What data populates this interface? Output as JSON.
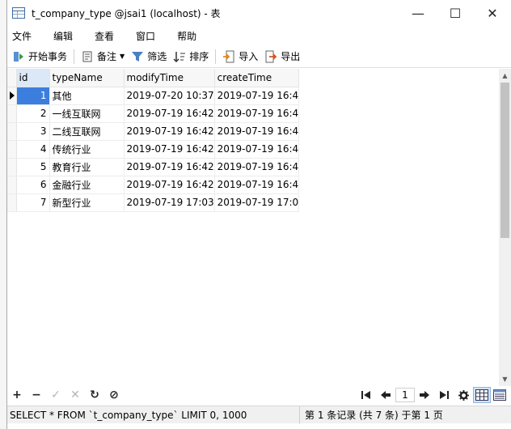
{
  "window": {
    "title": "t_company_type @jsai1 (localhost) - 表",
    "minimize": "—",
    "maximize": "☐",
    "close": "✕"
  },
  "menu": [
    "文件",
    "编辑",
    "查看",
    "窗口",
    "帮助"
  ],
  "toolbar": {
    "begin_transaction": "开始事务",
    "memo": "备注",
    "filter": "筛选",
    "sort": "排序",
    "import": "导入",
    "export": "导出"
  },
  "grid": {
    "columns": [
      "id",
      "typeName",
      "modifyTime",
      "createTime"
    ],
    "rows": [
      {
        "id": "1",
        "typeName": "其他",
        "modifyTime": "2019-07-20 10:37",
        "createTime": "2019-07-19 16:4"
      },
      {
        "id": "2",
        "typeName": "一线互联网",
        "modifyTime": "2019-07-19 16:42",
        "createTime": "2019-07-19 16:4"
      },
      {
        "id": "3",
        "typeName": "二线互联网",
        "modifyTime": "2019-07-19 16:42",
        "createTime": "2019-07-19 16:4"
      },
      {
        "id": "4",
        "typeName": "传统行业",
        "modifyTime": "2019-07-19 16:42",
        "createTime": "2019-07-19 16:4"
      },
      {
        "id": "5",
        "typeName": "教育行业",
        "modifyTime": "2019-07-19 16:42",
        "createTime": "2019-07-19 16:4"
      },
      {
        "id": "6",
        "typeName": "金融行业",
        "modifyTime": "2019-07-19 16:42",
        "createTime": "2019-07-19 16:4"
      },
      {
        "id": "7",
        "typeName": "新型行业",
        "modifyTime": "2019-07-19 17:03",
        "createTime": "2019-07-19 17:0"
      }
    ]
  },
  "bottom": {
    "add": "+",
    "remove": "−",
    "apply": "✓",
    "discard": "✕",
    "refresh": "↻",
    "stop": "⊘",
    "page": "1"
  },
  "status": {
    "sql": "SELECT * FROM `t_company_type` LIMIT 0, 1000",
    "records": "第 1 条记录 (共 7 条) 于第 1 页"
  }
}
